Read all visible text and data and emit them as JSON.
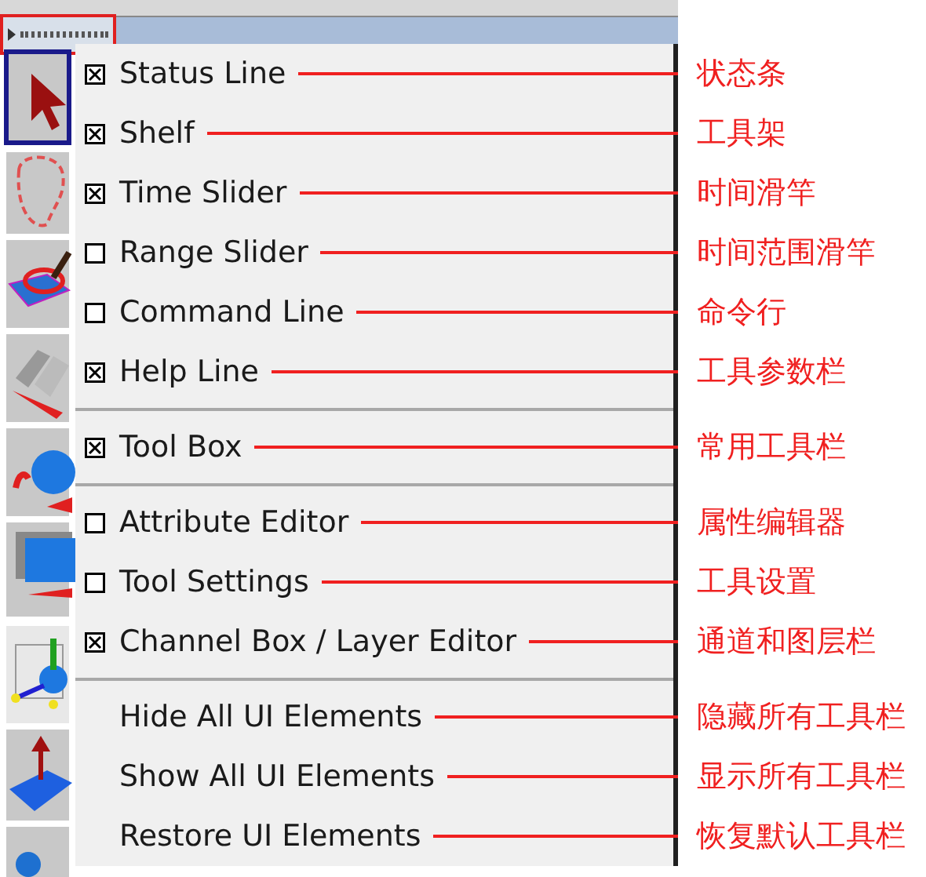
{
  "menu": {
    "items": [
      {
        "kind": "toggle",
        "label": "Status Line",
        "checked": true,
        "note": "状态条"
      },
      {
        "kind": "toggle",
        "label": "Shelf",
        "checked": true,
        "note": "工具架"
      },
      {
        "kind": "toggle",
        "label": "Time Slider",
        "checked": true,
        "note": "时间滑竿"
      },
      {
        "kind": "toggle",
        "label": "Range Slider",
        "checked": false,
        "note": "时间范围滑竿"
      },
      {
        "kind": "toggle",
        "label": "Command Line",
        "checked": false,
        "note": "命令行"
      },
      {
        "kind": "toggle",
        "label": "Help Line",
        "checked": true,
        "note": "工具参数栏"
      },
      {
        "kind": "separator"
      },
      {
        "kind": "toggle",
        "label": "Tool Box",
        "checked": true,
        "note": "常用工具栏"
      },
      {
        "kind": "separator"
      },
      {
        "kind": "toggle",
        "label": "Attribute Editor",
        "checked": false,
        "note": "属性编辑器"
      },
      {
        "kind": "toggle",
        "label": "Tool Settings",
        "checked": false,
        "note": "工具设置"
      },
      {
        "kind": "toggle",
        "label": "Channel Box / Layer Editor",
        "checked": true,
        "note": "通道和图层栏"
      },
      {
        "kind": "separator"
      },
      {
        "kind": "action",
        "label": "Hide All UI Elements",
        "note": "隐藏所有工具栏"
      },
      {
        "kind": "action",
        "label": "Show All UI Elements",
        "note": "显示所有工具栏"
      },
      {
        "kind": "action",
        "label": "Restore UI Elements",
        "note": "恢复默认工具栏"
      }
    ]
  }
}
